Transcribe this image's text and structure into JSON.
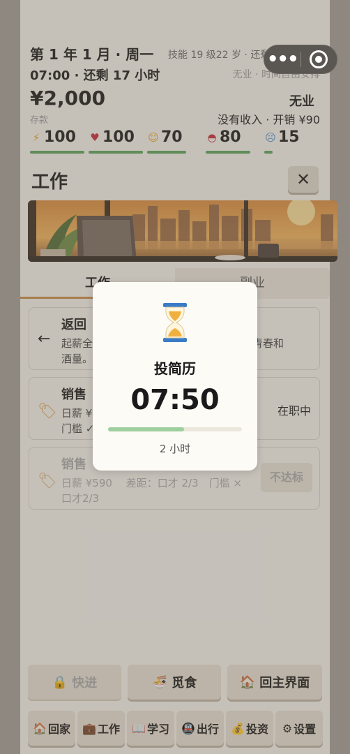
{
  "status": {
    "date": "第 1 年 1 月 · 周一",
    "skill_age": "技能 19 级22 岁 · 还剩 336 天",
    "time": "07:00 · 还剩 17 小时",
    "job_sub": "无业 · 时间自由安排",
    "money": "¥2,000",
    "job": "无业",
    "savings_label": "存款",
    "income": "没有收入 · 开销 ¥90",
    "stats": [
      {
        "icon": "lightning-icon",
        "value": "100",
        "level": 1.0
      },
      {
        "icon": "heart-icon",
        "value": "100",
        "level": 1.0
      },
      {
        "icon": "smile-icon",
        "value": "70",
        "level": 0.7
      },
      {
        "icon": "rice-bowl-icon",
        "value": "80",
        "level": 0.8
      },
      {
        "icon": "stress-face-icon",
        "value": "15",
        "level": 0.15
      }
    ]
  },
  "work": {
    "title": "工作",
    "close": "✕"
  },
  "tabs": [
    {
      "label": "工作",
      "active": true
    },
    {
      "label": "副业",
      "active": false
    }
  ],
  "cards": [
    {
      "lead": "←",
      "title": "返回",
      "desc_start": "起薪全",
      "desc_end": "是青春和",
      "desc_line2": "酒量。"
    },
    {
      "lead_icon": "tag-icon",
      "title": "销售",
      "desc_line1": "日薪 ¥",
      "desc_line2": "门槛 ✓",
      "right": "在职中"
    },
    {
      "lead_icon": "tag-icon",
      "title": "销售",
      "desc_line1": "日薪 ¥590　 差距：口才 2/3　门槛 ×",
      "desc_line2": "口才2/3",
      "button": "不达标"
    }
  ],
  "actions": {
    "fast": "快进",
    "food": "觅食",
    "home": "回主界面"
  },
  "nav": [
    {
      "label": "回家",
      "icon": "house-icon"
    },
    {
      "label": "工作",
      "icon": "briefcase-icon"
    },
    {
      "label": "学习",
      "icon": "book-icon"
    },
    {
      "label": "出行",
      "icon": "metro-icon"
    },
    {
      "label": "投资",
      "icon": "money-bag-icon"
    },
    {
      "label": "设置",
      "icon": "gear-icon"
    }
  ],
  "modal": {
    "title": "投简历",
    "time": "07:50",
    "progress": 0.57,
    "hours": "2 小时"
  },
  "colors": {
    "progress_green": "#5aa35a",
    "accent_orange": "#c98b45"
  }
}
